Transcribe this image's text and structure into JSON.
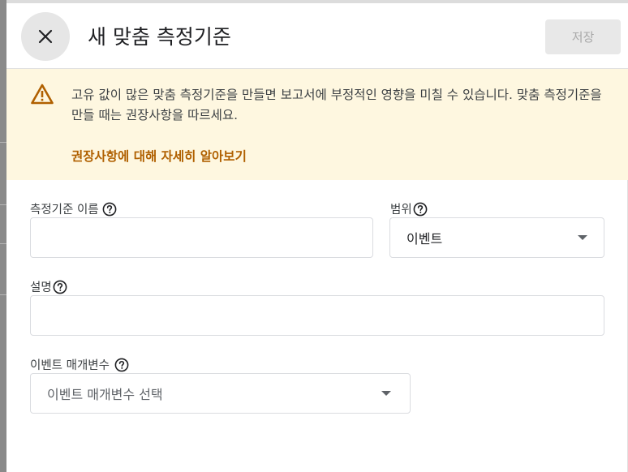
{
  "header": {
    "title": "새 맞춤 측정기준",
    "save_label": "저장",
    "close_icon": "close-icon"
  },
  "banner": {
    "icon": "warning-icon",
    "message": "고유 값이 많은 맞춤 측정기준을 만들면 보고서에 부정적인 영향을 미칠 수 있습니다. 맞춤 측정기준을 만들 때는 권장사항을 따르세요.",
    "link_label": "권장사항에 대해 자세히 알아보기",
    "background_color": "#fef7e0",
    "link_color": "#b06000"
  },
  "form": {
    "dimension_name": {
      "label": "측정기준 이름",
      "value": ""
    },
    "scope": {
      "label": "범위",
      "selected": "이벤트"
    },
    "description": {
      "label": "설명",
      "value": ""
    },
    "event_parameter": {
      "label": "이벤트 매개변수",
      "placeholder": "이벤트 매개변수 선택"
    }
  }
}
